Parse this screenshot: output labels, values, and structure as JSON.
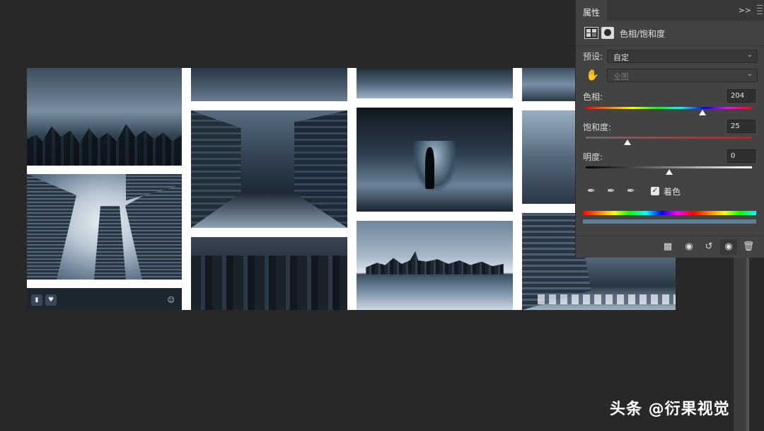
{
  "panel": {
    "tab_label": "属性",
    "collapse_glyph": ">>",
    "adjustment_title": "色相/饱和度",
    "preset_label": "预设:",
    "preset_value": "自定",
    "range_value": "全图",
    "hue": {
      "label": "色相:",
      "value": "204",
      "fraction": 0.7
    },
    "saturation": {
      "label": "饱和度:",
      "value": "25",
      "fraction": 0.25
    },
    "lightness": {
      "label": "明度:",
      "value": "0",
      "fraction": 0.5
    },
    "colorize_label": "着色",
    "colorize_checked": true,
    "tint_color": "#5e7e98"
  },
  "canvas_overlay": {
    "pin_icon": "bookmark-icon",
    "heart_icon": "heart-icon"
  },
  "watermark": "头条 @衍果视觉"
}
